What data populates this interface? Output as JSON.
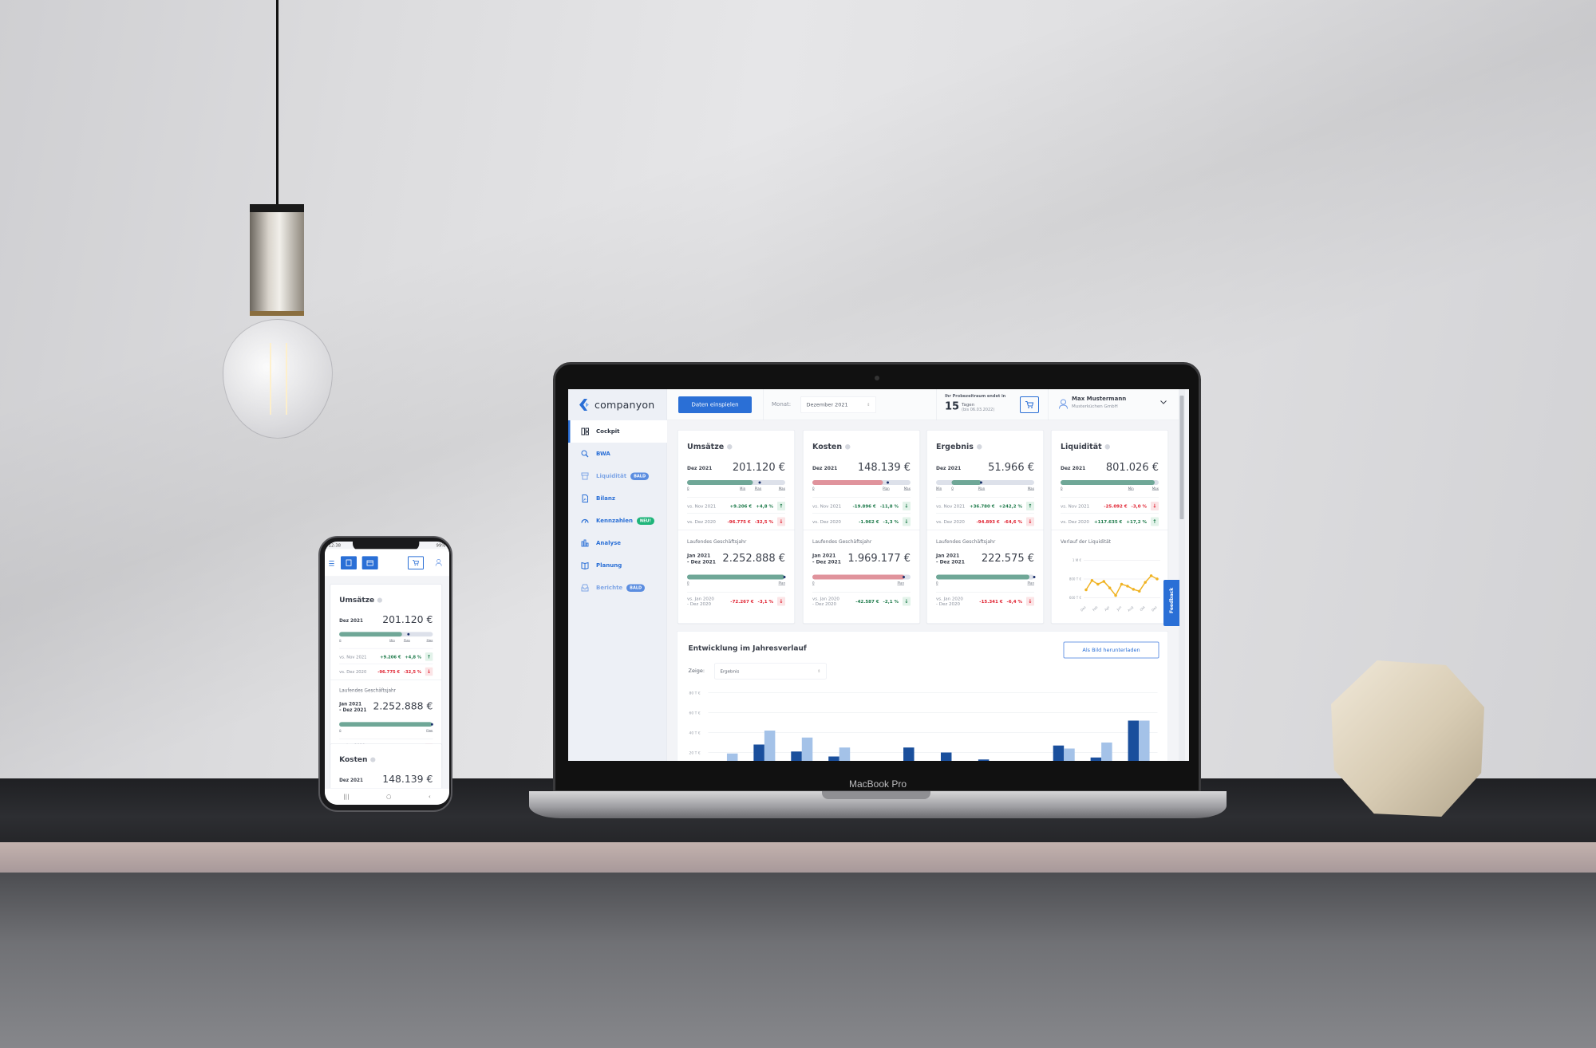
{
  "scene": {
    "laptop_label": "MacBook Pro"
  },
  "app": {
    "logo_text": "companyon",
    "accent_color": "#2a6fd6",
    "sidebar": {
      "items": [
        {
          "label": "Cockpit",
          "icon": "layout-icon",
          "active": true
        },
        {
          "label": "BWA",
          "icon": "search-chart-icon"
        },
        {
          "label": "Liquidität",
          "icon": "cash-register-icon",
          "badge": "BALD"
        },
        {
          "label": "Bilanz",
          "icon": "document-chart-icon"
        },
        {
          "label": "Kennzahlen",
          "icon": "gauge-icon",
          "badge": "NEU!"
        },
        {
          "label": "Analyse",
          "icon": "bar-chart-icon"
        },
        {
          "label": "Planung",
          "icon": "book-icon"
        },
        {
          "label": "Berichte",
          "icon": "inbox-icon",
          "badge": "BALD"
        }
      ]
    },
    "header": {
      "import_button": "Daten einspielen",
      "month_label": "Monat:",
      "month_value": "Dezember 2021",
      "trial": {
        "text": "Ihr Probezeitraum endet in",
        "days": "15",
        "unit": "Tagen",
        "until": "(bis 06.03.2022)"
      },
      "user": {
        "name": "Max Mustermann",
        "company": "Musterküchen GmbH"
      }
    },
    "feedback_label": "Feedback",
    "cards": [
      {
        "title": "Umsätze",
        "bar_color": "#6fa797",
        "month": {
          "period": "Dez 2021",
          "value": "201.120 €",
          "bar": {
            "fill_start": 0,
            "fill": 0.67,
            "marker": 0.74,
            "labels": [
              {
                "text": "0",
                "at": 0
              },
              {
                "text": "Min",
                "at": 0.57
              },
              {
                "text": "Plan",
                "at": 0.74
              },
              {
                "text": "Max",
                "at": 1
              }
            ]
          },
          "comparisons": [
            {
              "label": "vs. Nov 2021",
              "abs": "+9.206 €",
              "pct": "+4,8 %",
              "dir": "up",
              "tone": "good"
            },
            {
              "label": "vs. Dez 2020",
              "abs": "-96.775 €",
              "pct": "-32,5 %",
              "dir": "down",
              "tone": "bad"
            }
          ]
        },
        "ytd": {
          "heading": "Laufendes Geschäftsjahr",
          "period1": "Jan 2021",
          "period2": "- Dez 2021",
          "value": "2.252.888 €",
          "bar": {
            "fill_start": 0,
            "fill": 0.99,
            "marker": 0.99,
            "labels": [
              {
                "text": "0",
                "at": 0
              },
              {
                "text": "Plan",
                "at": 1
              }
            ]
          },
          "comparison": {
            "label1": "vs. Jan 2020",
            "label2": "- Dez 2020",
            "abs": "-72.267 €",
            "pct": "-3,1 %",
            "dir": "down",
            "tone": "bad"
          }
        }
      },
      {
        "title": "Kosten",
        "bar_color": "#e0939c",
        "month": {
          "period": "Dez 2021",
          "value": "148.139 €",
          "bar": {
            "fill_start": 0,
            "fill": 0.72,
            "marker": 0.77,
            "labels": [
              {
                "text": "0",
                "at": 0
              },
              {
                "text": "Plan",
                "at": 0.77
              },
              {
                "text": "Max",
                "at": 1
              }
            ]
          },
          "comparisons": [
            {
              "label": "vs. Nov 2021",
              "abs": "-19.896 €",
              "pct": "-11,8 %",
              "dir": "down",
              "tone": "good"
            },
            {
              "label": "vs. Dez 2020",
              "abs": "-1.962 €",
              "pct": "-1,3 %",
              "dir": "down",
              "tone": "good"
            }
          ]
        },
        "ytd": {
          "heading": "Laufendes Geschäftsjahr",
          "period1": "Jan 2021",
          "period2": "- Dez 2021",
          "value": "1.969.177 €",
          "bar": {
            "fill_start": 0,
            "fill": 0.94,
            "marker": 0.93,
            "labels": [
              {
                "text": "0",
                "at": 0
              },
              {
                "text": "Plan",
                "at": 0.93
              }
            ]
          },
          "comparison": {
            "label1": "vs. Jan 2020",
            "label2": "- Dez 2020",
            "abs": "-42.587 €",
            "pct": "-2,1 %",
            "dir": "down",
            "tone": "good"
          }
        }
      },
      {
        "title": "Ergebnis",
        "bar_color": "#6fa797",
        "month": {
          "period": "Dez 2021",
          "value": "51.966 €",
          "bar": {
            "fill_start": 0.16,
            "fill": 0.46,
            "marker": 0.46,
            "labels": [
              {
                "text": "Min",
                "at": 0
              },
              {
                "text": "0",
                "at": 0.16
              },
              {
                "text": "Plan",
                "at": 0.46
              },
              {
                "text": "Max",
                "at": 1
              }
            ]
          },
          "comparisons": [
            {
              "label": "vs. Nov 2021",
              "abs": "+36.780 €",
              "pct": "+242,2 %",
              "dir": "up",
              "tone": "good"
            },
            {
              "label": "vs. Dez 2020",
              "abs": "-94.893 €",
              "pct": "-64,6 %",
              "dir": "down",
              "tone": "bad"
            }
          ]
        },
        "ytd": {
          "heading": "Laufendes Geschäftsjahr",
          "period1": "Jan 2021",
          "period2": "- Dez 2021",
          "value": "222.575 €",
          "bar": {
            "fill_start": 0,
            "fill": 0.95,
            "marker": 1,
            "labels": [
              {
                "text": "0",
                "at": 0
              },
              {
                "text": "Plan",
                "at": 1
              }
            ]
          },
          "comparison": {
            "label1": "vs. Jan 2020",
            "label2": "- Dez 2020",
            "abs": "-15.341 €",
            "pct": "-6,4 %",
            "dir": "down",
            "tone": "bad"
          }
        }
      },
      {
        "title": "Liquidität",
        "bar_color": "#6fa797",
        "month": {
          "period": "Dez 2021",
          "value": "801.026 €",
          "bar": {
            "fill_start": 0,
            "fill": 0.96,
            "labels": [
              {
                "text": "0",
                "at": 0
              },
              {
                "text": "Min",
                "at": 0.73
              },
              {
                "text": "Max",
                "at": 1
              }
            ]
          },
          "comparisons": [
            {
              "label": "vs. Nov 2021",
              "abs": "-25.092 €",
              "pct": "-3,0 %",
              "dir": "down",
              "tone": "bad"
            },
            {
              "label": "vs. Dez 2020",
              "abs": "+117.635 €",
              "pct": "+17,2 %",
              "dir": "up",
              "tone": "good"
            }
          ]
        },
        "trend": {
          "heading": "Verlauf der Liquidität",
          "y_ticks": [
            {
              "label": "1 M €",
              "value": 1000
            },
            {
              "label": "800 T €",
              "value": 800
            },
            {
              "label": "600 T €",
              "value": 600
            }
          ],
          "x_labels": [
            "Dez",
            "Feb",
            "Apr",
            "Jun",
            "Aug",
            "Okt",
            "Dez"
          ],
          "values_tsd": [
            685,
            785,
            745,
            775,
            705,
            625,
            745,
            725,
            690,
            670,
            765,
            835,
            801
          ],
          "color": "#f0b323"
        }
      }
    ],
    "development": {
      "title": "Entwicklung im Jahresverlauf",
      "download_button": "Als Bild herunterladen",
      "show_label": "Zeige:",
      "show_value": "Ergebnis"
    }
  },
  "chart_data": {
    "type": "bar",
    "title": "Entwicklung im Jahresverlauf",
    "y_ticks": [
      "80 T €",
      "60 T €",
      "40 T €",
      "20 T €"
    ],
    "ylim": [
      0,
      80
    ],
    "unit": "T €",
    "grid": true,
    "series": [
      {
        "color": "#1a4f9c",
        "values": [
          null,
          28,
          21,
          16,
          null,
          25,
          20,
          13,
          null,
          27,
          15,
          52
        ]
      },
      {
        "color": "#a4c2e8",
        "values": [
          19,
          42,
          35,
          25,
          null,
          null,
          null,
          null,
          null,
          24,
          30,
          52
        ]
      }
    ]
  },
  "phone": {
    "time": "12:38",
    "battery": "99%"
  }
}
